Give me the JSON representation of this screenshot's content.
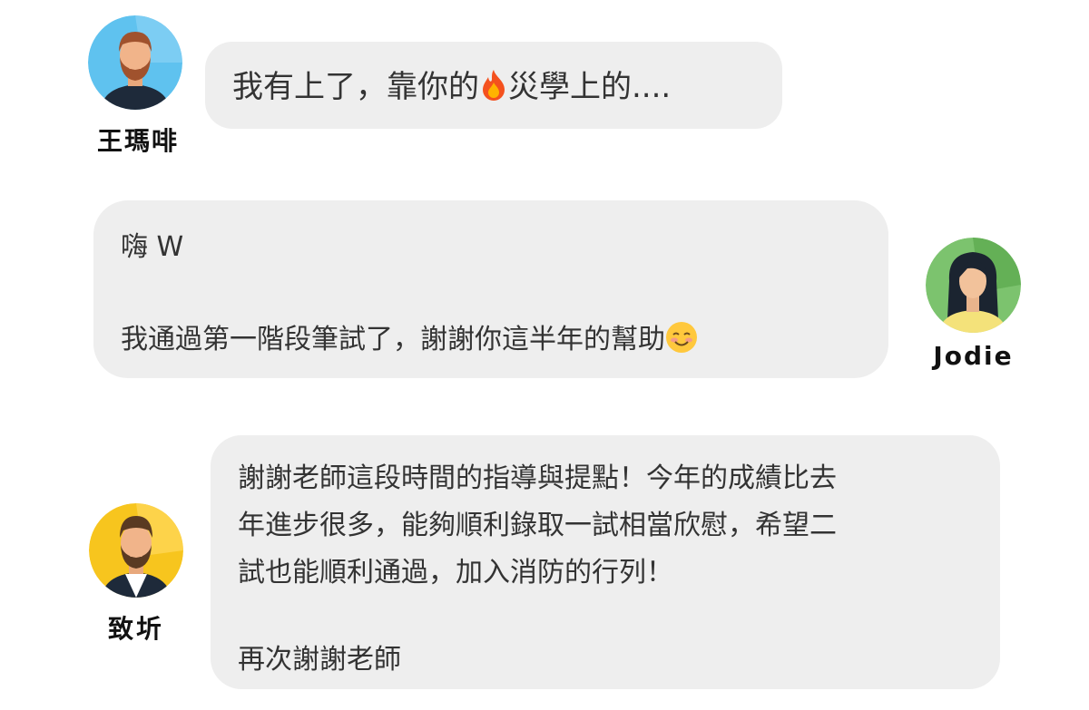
{
  "messages": [
    {
      "sender": "王瑪啡",
      "side": "left",
      "avatar_icon": "bearded-man-avatar-icon",
      "avatar_bg": "#5fc2ef",
      "text_before_emoji": "我有上了，靠你的",
      "emoji": "fire-emoji-icon",
      "text_after_emoji": "災學上的...."
    },
    {
      "sender": "Jodie",
      "side": "right",
      "avatar_icon": "woman-avatar-icon",
      "avatar_bg": "#5cb85c",
      "line1": "嗨 W",
      "line2": "我通過第一階段筆試了，謝謝你這半年的幫助",
      "emoji": "smiling-face-emoji-icon"
    },
    {
      "sender": "致圻",
      "side": "left",
      "avatar_icon": "bearded-man-avatar-icon",
      "avatar_bg": "#f7c51e",
      "lines": [
        "謝謝老師這段時間的指導與提點！今年的成績比去",
        "年進步很多，能夠順利錄取一試相當欣慰，希望二",
        "試也能順利通過，加入消防的行列！"
      ],
      "closing": "再次謝謝老師"
    }
  ],
  "colors": {
    "bubble_bg": "#eeeeee",
    "text": "#333333",
    "name_text": "#111111"
  }
}
